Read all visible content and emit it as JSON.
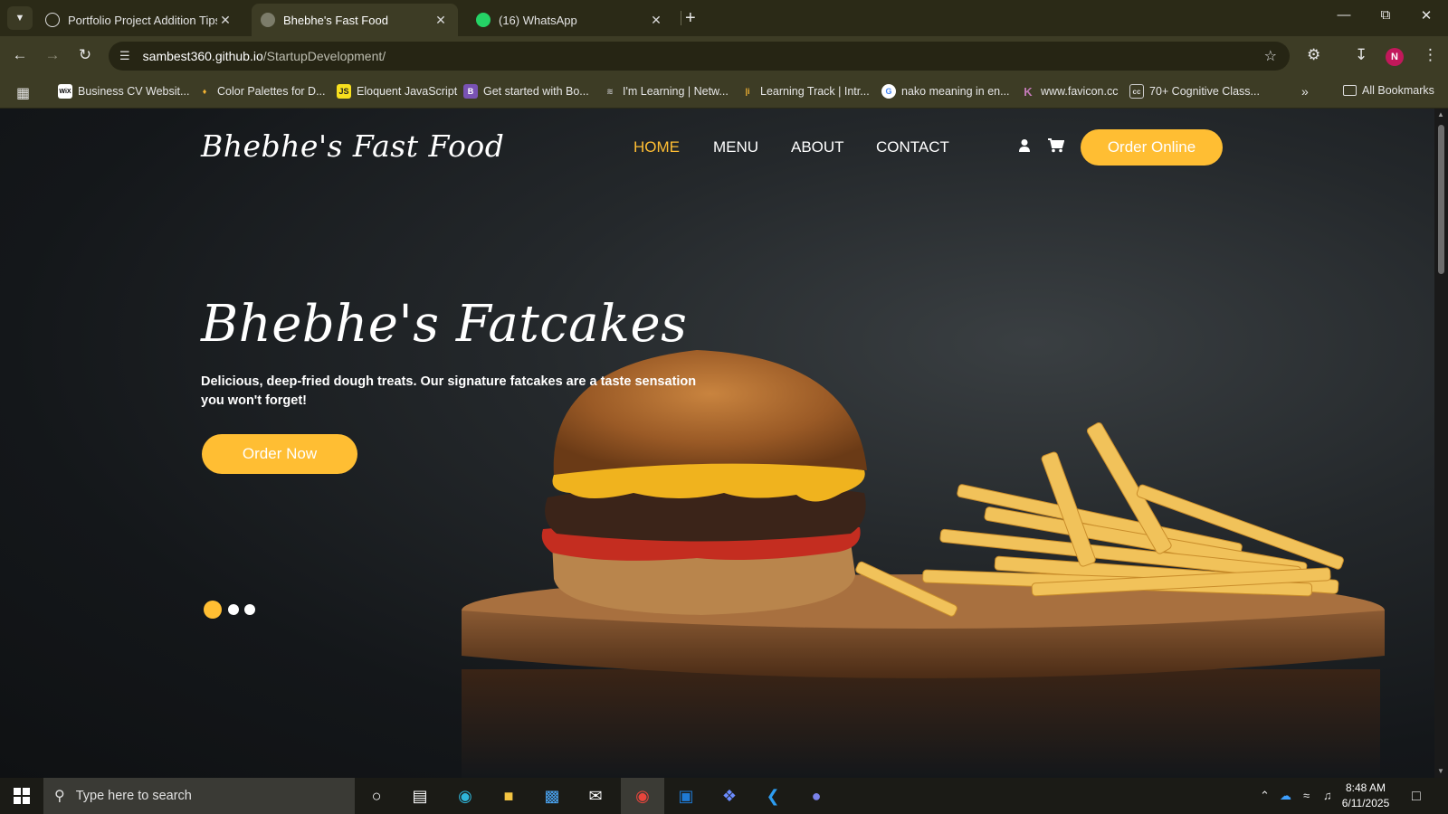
{
  "browser": {
    "tabs": [
      {
        "title": "Portfolio Project Addition Tips",
        "icon": "openai-icon",
        "active": false
      },
      {
        "title": "Bhebhe's Fast Food",
        "icon": "globe-icon",
        "active": true
      },
      {
        "title": "(16) WhatsApp",
        "icon": "whatsapp-icon",
        "active": false
      }
    ],
    "url_host": "sambest360.github.io",
    "url_path": "/StartupDevelopment/",
    "profile_initial": "N",
    "bookmarks": [
      {
        "label": "Business CV Websit...",
        "icon": "wix-icon",
        "glyph": "WiX"
      },
      {
        "label": "Color Palettes for D...",
        "icon": "palette-icon",
        "glyph": "♦"
      },
      {
        "label": "Eloquent JavaScript",
        "icon": "js-icon",
        "glyph": "JS"
      },
      {
        "label": "Get started with Bo...",
        "icon": "bootstrap-icon",
        "glyph": "B"
      },
      {
        "label": "I'm Learning | Netw...",
        "icon": "cisco-icon",
        "glyph": "≋"
      },
      {
        "label": "Learning Track | Intr...",
        "icon": "track-icon",
        "glyph": "|i"
      },
      {
        "label": "nako meaning in en...",
        "icon": "google-icon",
        "glyph": "G"
      },
      {
        "label": "www.favicon.cc",
        "icon": "favicon-icon",
        "glyph": "K"
      },
      {
        "label": "70+ Cognitive Class...",
        "icon": "cc-icon",
        "glyph": "cc"
      }
    ],
    "all_bookmarks_label": "All Bookmarks"
  },
  "site": {
    "logo": "Bhebhe's Fast Food",
    "nav": [
      "HOME",
      "MENU",
      "ABOUT",
      "CONTACT"
    ],
    "active_nav": "HOME",
    "order_online": "Order Online",
    "hero": {
      "title": "Bhebhe's Fatcakes",
      "description": "Delicious, deep-fried dough treats. Our signature fatcakes are a taste sensation you won't forget!",
      "button": "Order Now",
      "slides_total": 3,
      "slide_active": 1
    },
    "colors": {
      "accent": "#ffbe33",
      "text": "#ffffff",
      "background": "#14171a"
    }
  },
  "taskbar": {
    "search_placeholder": "Type here to search",
    "time": "8:48 AM",
    "date": "6/11/2025"
  }
}
